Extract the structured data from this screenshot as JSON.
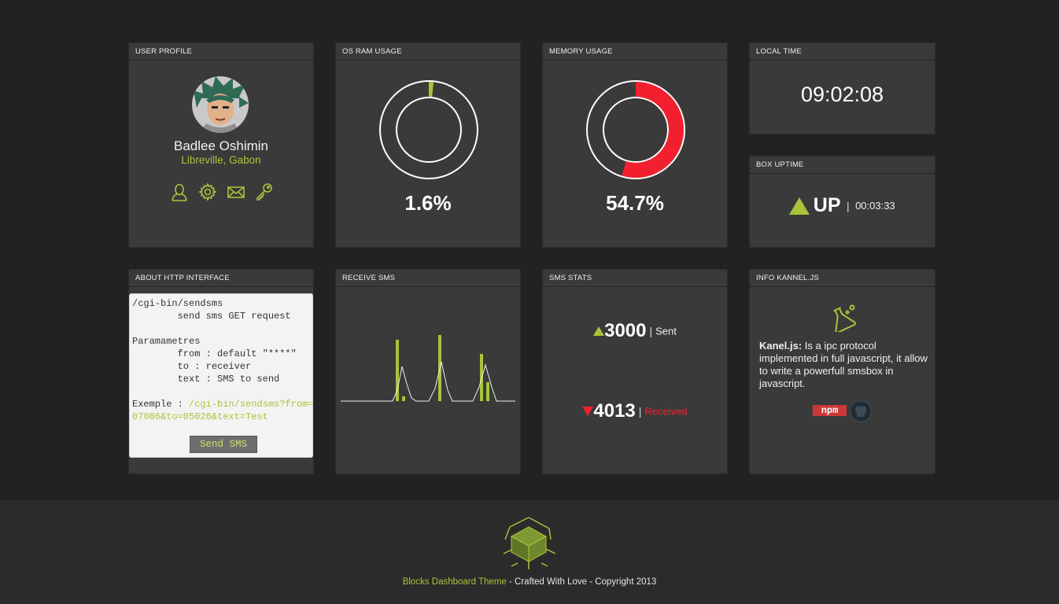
{
  "panels": {
    "user_profile": {
      "title": "USER PROFILE",
      "name": "Badlee Oshimin",
      "location": "Libreville, Gabon",
      "icons": [
        "user-icon",
        "gear-icon",
        "mail-icon",
        "key-icon"
      ]
    },
    "os_ram": {
      "title": "OS RAM USAGE",
      "value": "1.6%",
      "fraction": 0.016
    },
    "memory": {
      "title": "MEMORY USAGE",
      "value": "54.7%",
      "fraction": 0.547
    },
    "local_time": {
      "title": "LOCAL TIME",
      "value": "09:02:08"
    },
    "box_uptime": {
      "title": "BOX UPTIME",
      "status": "UP",
      "separator": "|",
      "time": "00:03:33"
    },
    "http": {
      "title": "ABOUT HTTP INTERFACE",
      "line1": "/cgi-bin/sendsms",
      "line2": "        send sms GET request",
      "line3": "Paramametres",
      "line4": "        from : default \"****\"",
      "line5": "        to : receiver",
      "line6": "        text : SMS to send",
      "example_label": "Exemple : ",
      "example_url_1": "/cgi-bin/sendsms?from=",
      "example_url_2": "07086&to=05026&text=Test",
      "button": "Send SMS"
    },
    "receive_sms": {
      "title": "RECEIVE SMS"
    },
    "sms_stats": {
      "title": "SMS STATS",
      "sent_value": "3000",
      "sent_label": "Sent",
      "received_value": "4013",
      "received_label": "Received",
      "separator": "|"
    },
    "info": {
      "title": "INFO KANNEL.JS",
      "bold": "Kanel.js:",
      "text": " Is a ipc protocol implemented in full javascript, it allow to write a powerfull smsbox in javascript.",
      "npm_label": "npm"
    }
  },
  "footer": {
    "theme": "Blocks Dashboard Theme",
    "rest": " - Crafted With Love - Copyright 2013"
  },
  "colors": {
    "accent": "#a8c43a",
    "danger": "#f2202e",
    "panel": "#3a3a3a",
    "background": "#222222"
  }
}
